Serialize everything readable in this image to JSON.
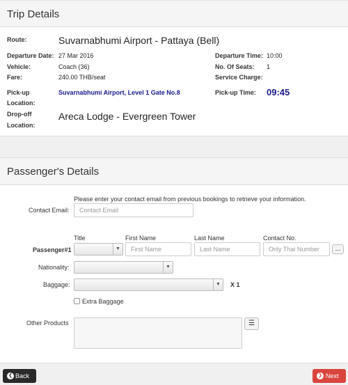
{
  "trip": {
    "title": "Trip Details",
    "route_label": "Route:",
    "route_value": "Suvarnabhumi Airport - Pattaya (Bell)",
    "departure_date_label": "Departure Date:",
    "departure_date_value": "27 Mar 2016",
    "vehicle_label": "Vehicle:",
    "vehicle_value": "Coach (36)",
    "fare_label": "Fare:",
    "fare_value": "240.00 THB/seat",
    "pickup_label_1": "Pick-up",
    "pickup_label_2": "Location:",
    "pickup_value": "Suvarnabhumi Airport, Level 1 Gate No.8",
    "dropoff_label_1": "Drop-off",
    "dropoff_label_2": "Location:",
    "dropoff_value": "Areca Lodge - Evergreen Tower",
    "departure_time_label": "Departure Time:",
    "departure_time_value": "10:00",
    "seats_label": "No. Of Seats:",
    "seats_value": "1",
    "service_charge_label": "Service Charge:",
    "service_charge_value": "",
    "pickup_time_label": "Pick-up Time:",
    "pickup_time_value": "09:45"
  },
  "passenger": {
    "title": "Passenger's Details",
    "email_hint": "Please enter your contact email from previous bookings to retrieve your information.",
    "email_label": "Contact Email:",
    "email_placeholder": "Contact Email",
    "col_title": "Title",
    "col_first": "First Name",
    "col_last": "Last Name",
    "col_contact": "Contact No.",
    "row_label": "Passenger#1",
    "title_value": "",
    "first_placeholder": "First Name",
    "last_placeholder": "Last Name",
    "contact_placeholder": "Only Thai Number",
    "more_button": "...",
    "nationality_label": "Nationality:",
    "nationality_value": "",
    "baggage_label": "Baggage:",
    "baggage_value": "",
    "baggage_qty": "X 1",
    "extra_baggage_label": "Extra Baggage",
    "other_products_label": "Other Products"
  },
  "footer": {
    "back_label": "Back",
    "next_label": "Next"
  },
  "icons": {
    "caret": "▼",
    "list": "☰",
    "back_arrow": "❮",
    "next_arrow": "❯"
  },
  "colors": {
    "link": "#1a1a8c",
    "back_button": "#2a2a2a",
    "next_button": "#d9453d"
  }
}
